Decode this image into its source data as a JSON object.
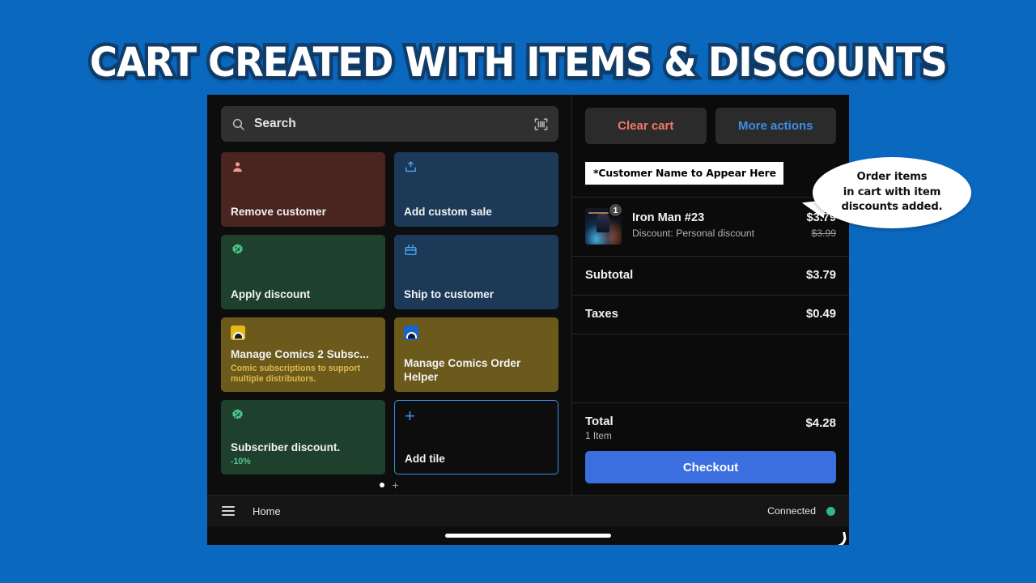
{
  "banner": {
    "title": "CART CREATED WITH ITEMS & DISCOUNTS"
  },
  "colors": {
    "background": "#0b68bf",
    "banner_outline": "#123e6b",
    "accent_blue": "#3b8fe8",
    "checkout_blue": "#3b6fe0",
    "danger_red": "#f5766a",
    "status_green": "#2fb97f",
    "tile_maroon": "#4a2520",
    "tile_navy": "#1c3a57",
    "tile_green": "#20402e",
    "tile_gold": "#6b5a1b"
  },
  "search": {
    "placeholder": "Search",
    "icon": "search-icon",
    "scan_icon": "barcode-scanner-icon"
  },
  "tiles": [
    {
      "id": "remove-customer",
      "label": "Remove customer",
      "sub": "",
      "icon": "person-icon",
      "variant": "t-remove"
    },
    {
      "id": "add-custom-sale",
      "label": "Add custom sale",
      "sub": "",
      "icon": "upload-box-icon",
      "variant": "t-custom"
    },
    {
      "id": "apply-discount",
      "label": "Apply discount",
      "sub": "",
      "icon": "discount-badge-icon",
      "variant": "t-discount"
    },
    {
      "id": "ship-to-customer",
      "label": "Ship to customer",
      "sub": "",
      "icon": "shipping-box-icon",
      "variant": "t-ship"
    },
    {
      "id": "manage-comics-2-subscriptions",
      "label": "Manage Comics 2 Subsc...",
      "sub": "Comic subscriptions to support\nmultiple distributors.",
      "icon": "app-dome-icon",
      "variant": "t-app1"
    },
    {
      "id": "manage-comics-order-helper",
      "label": "Manage Comics Order\nHelper",
      "sub": "",
      "icon": "app-dome-icon",
      "variant": "t-app2"
    },
    {
      "id": "subscriber-discount",
      "label": "Subscriber discount.",
      "sub": "-10%",
      "icon": "discount-badge-icon",
      "variant": "t-subdisc"
    },
    {
      "id": "add-tile",
      "label": "Add tile",
      "sub": "",
      "icon": "plus-icon",
      "variant": "t-add"
    }
  ],
  "pager": {
    "active_dot": "•",
    "add_page": "+"
  },
  "cart": {
    "clear_label": "Clear cart",
    "more_label": "More actions",
    "customer_chip": "*Customer Name to Appear Here",
    "items": [
      {
        "title": "Iron Man #23",
        "subtitle": "Discount: Personal discount",
        "price": "$3.79",
        "compare_price": "$3.99",
        "quantity": "1"
      }
    ],
    "totals": [
      {
        "label": "Subtotal",
        "value": "$3.79"
      },
      {
        "label": "Taxes",
        "value": "$0.49"
      }
    ],
    "grand_total": {
      "label": "Total",
      "count": "1 Item",
      "value": "$4.28"
    },
    "checkout_label": "Checkout"
  },
  "navbar": {
    "menu_icon": "hamburger-menu-icon",
    "home_label": "Home",
    "status_label": "Connected"
  },
  "annotation": {
    "bubble_text": "Order items\nin cart with item\ndiscounts added."
  }
}
